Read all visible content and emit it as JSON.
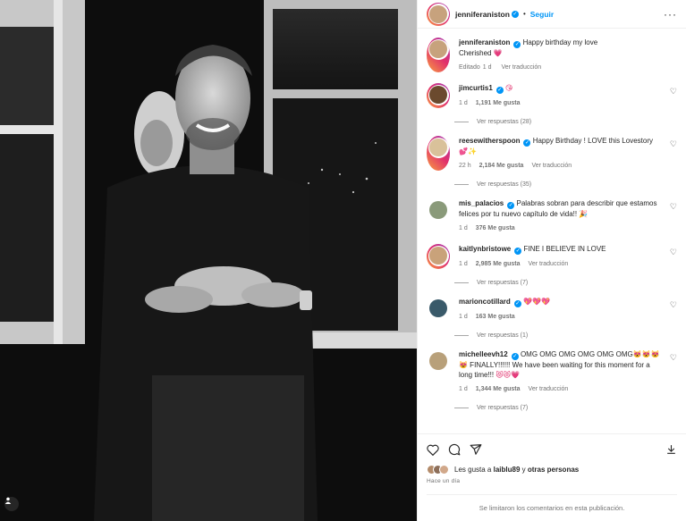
{
  "post": {
    "author": "jenniferaniston",
    "follow_label": "Seguir",
    "caption_line1": "Happy birthday my love",
    "caption_line2": "Cherished",
    "caption_emoji": "💗",
    "edited": "Editado",
    "caption_time": "1 d",
    "see_translation": "Ver traducción"
  },
  "comments": [
    {
      "user": "jimcurtis1",
      "text": "",
      "emoji": "😘",
      "time": "1 d",
      "likes": "1,191 Me gusta",
      "translate": "",
      "replies": "Ver respuestas (28)",
      "avatar_color": "#6b4a2e",
      "ring": true
    },
    {
      "user": "reesewitherspoon",
      "text": "Happy Birthday ! LOVE this Lovestory",
      "emoji": "💕✨",
      "time": "22 h",
      "likes": "2,184 Me gusta",
      "translate": "Ver traducción",
      "replies": "Ver respuestas (35)",
      "avatar_color": "#d9c19a",
      "ring": true
    },
    {
      "user": "mis_palacios",
      "text": "Palabras sobran para describir que estamos felices por tu nuevo capítulo de vida!!",
      "emoji": "🎉",
      "time": "1 d",
      "likes": "376 Me gusta",
      "translate": "",
      "replies": "",
      "avatar_color": "#8a9a7a",
      "ring": false
    },
    {
      "user": "kaitlynbristowe",
      "text": "FINE I BELIEVE IN LOVE",
      "emoji": "",
      "time": "1 d",
      "likes": "2,985 Me gusta",
      "translate": "Ver traducción",
      "replies": "Ver respuestas (7)",
      "avatar_color": "#c9a27a",
      "ring": true
    },
    {
      "user": "marioncotillard",
      "text": "",
      "emoji": "💖💖💖",
      "time": "1 d",
      "likes": "163 Me gusta",
      "translate": "",
      "replies": "Ver respuestas (1)",
      "avatar_color": "#3a5a6a",
      "ring": false
    },
    {
      "user": "michelleevh12",
      "text": "OMG OMG OMG OMG OMG OMG😻😻😻😻 FINALLY!!!!!! We have been waiting for this moment for a long time!!!",
      "emoji": "😻😻💗",
      "time": "1 d",
      "likes": "1,344 Me gusta",
      "translate": "Ver traducción",
      "replies": "Ver respuestas (7)",
      "avatar_color": "#b8a07a",
      "ring": false
    }
  ],
  "likes_line": {
    "prefix": "Les gusta a",
    "user": "laiblu89",
    "mid": "y",
    "others": "otras personas"
  },
  "posted_ago": "Hace un día",
  "comments_limited": "Se limitaron los comentarios en esta publicación.",
  "colors": {
    "accent": "#0095f6",
    "heart": "#e1306c"
  }
}
